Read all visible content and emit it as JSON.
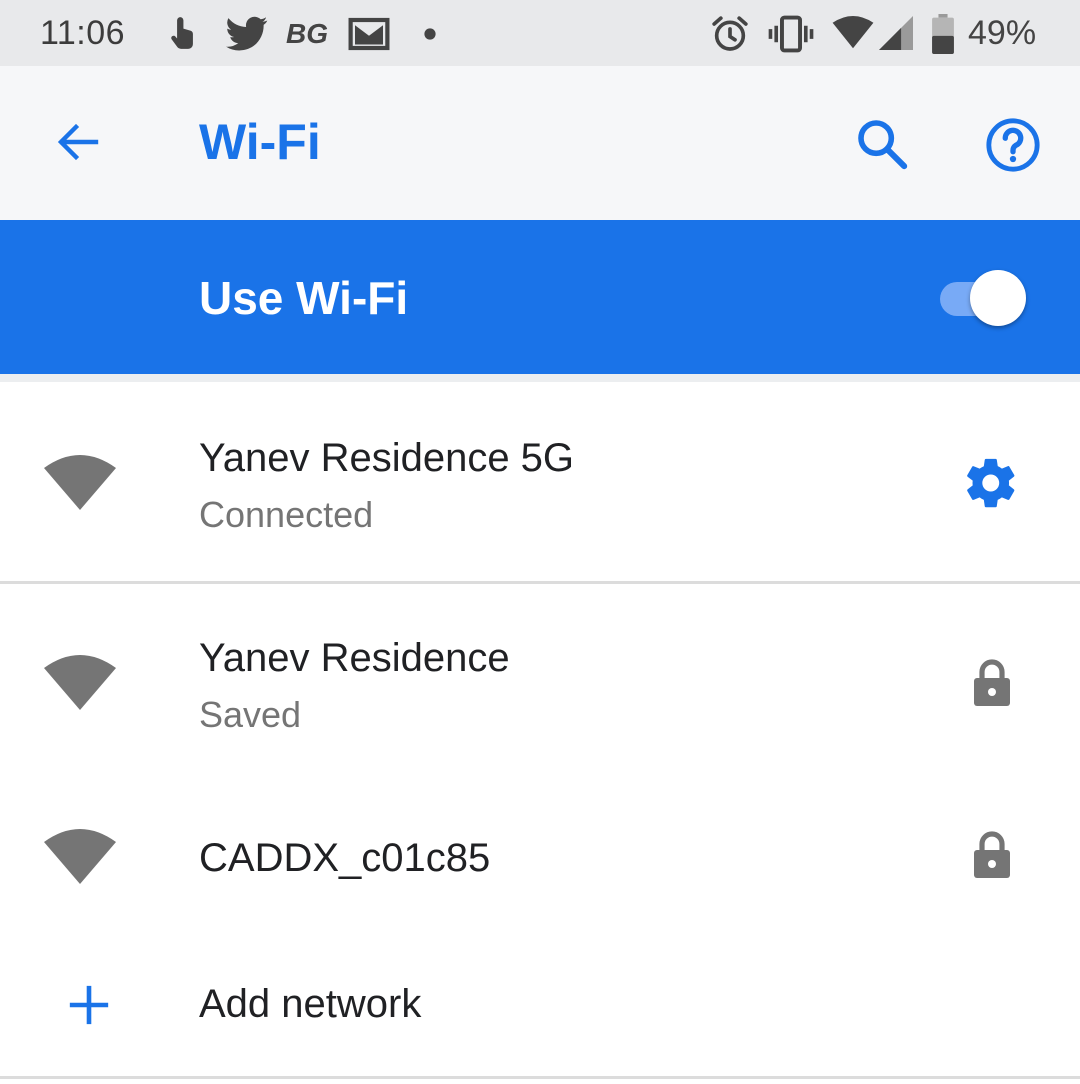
{
  "status_bar": {
    "time": "11:06",
    "notification_icons": [
      "touch-icon",
      "twitter-icon",
      "bg-icon",
      "gmail-icon",
      "dot-icon"
    ],
    "bg_text": "BG",
    "system_icons": [
      "alarm-icon",
      "vibrate-icon",
      "wifi-icon",
      "cell-signal-icon",
      "battery-icon"
    ],
    "battery_percent": "49%"
  },
  "app_bar": {
    "title": "Wi-Fi",
    "back_icon": "arrow-left-icon",
    "actions": [
      "search-icon",
      "help-icon"
    ]
  },
  "master_switch": {
    "label": "Use Wi-Fi",
    "enabled": true
  },
  "networks": [
    {
      "name": "Yanev Residence 5G",
      "status": "Connected",
      "trailing_icon": "gear-icon"
    },
    {
      "name": "Yanev Residence",
      "status": "Saved",
      "trailing_icon": "lock-icon"
    },
    {
      "name": "CADDX_c01c85",
      "status": "",
      "trailing_icon": "lock-icon"
    }
  ],
  "add_network": {
    "label": "Add network",
    "icon": "plus-icon"
  },
  "colors": {
    "accent": "#1a73e8",
    "status_bar_bg": "#e8e9eb",
    "app_bar_bg": "#f6f7f9",
    "icon_gray": "#757575"
  }
}
